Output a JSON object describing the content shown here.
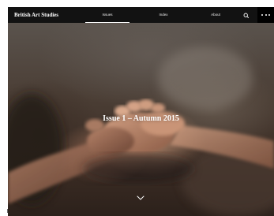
{
  "header": {
    "site_title": "British Art Studies",
    "nav": [
      {
        "label": "Issues",
        "active": true
      },
      {
        "label": "Index",
        "active": false
      },
      {
        "label": "About",
        "active": false
      }
    ],
    "search_icon": "search-icon",
    "menu_icon": "more-dots-icon"
  },
  "hero": {
    "title": "Issue 1 – Autumn 2015",
    "scroll_icon": "chevron-down-icon"
  },
  "colors": {
    "header_bg": "#121212",
    "menu_bg": "#000000",
    "text": "#ffffff"
  }
}
